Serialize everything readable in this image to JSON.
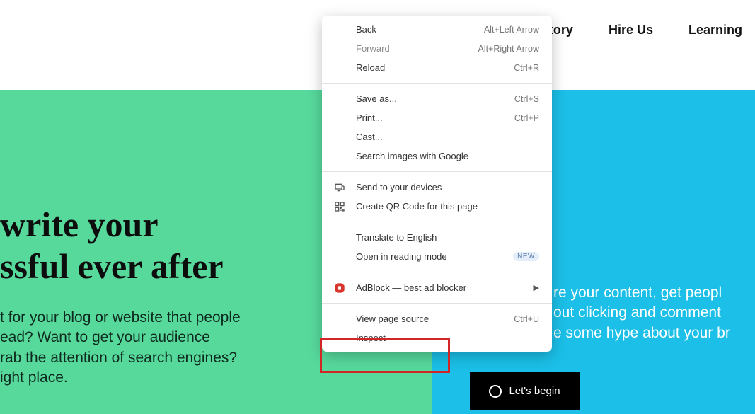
{
  "nav": {
    "items": [
      "tory",
      "Hire Us",
      "Learning"
    ]
  },
  "headline": {
    "line1": "write your",
    "line2": "ssful ever after"
  },
  "bodyLeft": {
    "l1": "t for your blog or website that people",
    "l2": "ead? Want to get your audience",
    "l3": "rab the attention of search engines?",
    "l4": "ight place."
  },
  "bodyRight": {
    "l1": "re your content, get peopl",
    "l2": "out clicking and comment",
    "l3": "e some hype about your br"
  },
  "cta": {
    "label": "Let's begin"
  },
  "menu": {
    "back": {
      "label": "Back",
      "shortcut": "Alt+Left Arrow"
    },
    "forward": {
      "label": "Forward",
      "shortcut": "Alt+Right Arrow"
    },
    "reload": {
      "label": "Reload",
      "shortcut": "Ctrl+R"
    },
    "saveas": {
      "label": "Save as...",
      "shortcut": "Ctrl+S"
    },
    "print": {
      "label": "Print...",
      "shortcut": "Ctrl+P"
    },
    "cast": {
      "label": "Cast..."
    },
    "searchImages": {
      "label": "Search images with Google"
    },
    "sendDevices": {
      "label": "Send to your devices"
    },
    "qr": {
      "label": "Create QR Code for this page"
    },
    "translate": {
      "label": "Translate to English"
    },
    "reading": {
      "label": "Open in reading mode",
      "badge": "NEW"
    },
    "adblock": {
      "label": "AdBlock — best ad blocker"
    },
    "viewSource": {
      "label": "View page source",
      "shortcut": "Ctrl+U"
    },
    "inspect": {
      "label": "Inspect"
    }
  }
}
